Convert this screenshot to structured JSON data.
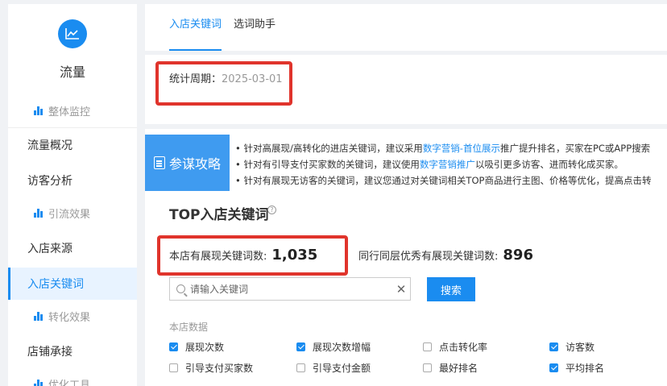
{
  "sidebar": {
    "title": "流量",
    "items": [
      {
        "label": "整体监控",
        "type": "sub"
      },
      {
        "label": "流量概况",
        "type": "top"
      },
      {
        "label": "访客分析",
        "type": "top"
      },
      {
        "label": "引流效果",
        "type": "sub"
      },
      {
        "label": "入店来源",
        "type": "top"
      },
      {
        "label": "入店关键词",
        "type": "top",
        "active": true
      },
      {
        "label": "转化效果",
        "type": "sub"
      },
      {
        "label": "店铺承接",
        "type": "top"
      },
      {
        "label": "优化工具",
        "type": "sub"
      }
    ]
  },
  "tabs": [
    {
      "label": "入店关键词",
      "active": true
    },
    {
      "label": "选词助手",
      "active": false
    }
  ],
  "period": {
    "label": "统计周期：",
    "value": "2025-03-01"
  },
  "tips": {
    "label": "参谋攻略",
    "lines": [
      {
        "pre": "• 针对高展现/高转化的进店关键词，建议采用",
        "link": "数字营销-首位展示",
        "post": "推广提升排名，买家在PC或APP搜索"
      },
      {
        "pre": "• 针对有引导支付买家数的关键词，建议使用",
        "link": "数字营销推广",
        "post": "以吸引更多访客、进而转化成买家。"
      },
      {
        "pre": "• 针对有展现无访客的关键词，建议您通过对关键词相关TOP商品进行主图、价格等优化，提高点击转",
        "link": "",
        "post": ""
      }
    ]
  },
  "section": {
    "title": "TOP入店关键词",
    "help_icon": "?"
  },
  "stats": {
    "shop_label": "本店有展现关键词数:",
    "shop_value": "1,035",
    "peer_label": "同行同层优秀有展现关键词数:",
    "peer_value": "896"
  },
  "search": {
    "placeholder": "请输入关键词",
    "value": "",
    "button": "搜索",
    "clear": "✕"
  },
  "metrics": {
    "group_label": "本店数据",
    "items": [
      {
        "label": "展现次数",
        "checked": true
      },
      {
        "label": "展现次数增幅",
        "checked": true
      },
      {
        "label": "点击转化率",
        "checked": false
      },
      {
        "label": "访客数",
        "checked": true
      },
      {
        "label": "引导支付买家数",
        "checked": false
      },
      {
        "label": "引导支付金额",
        "checked": false
      },
      {
        "label": "最好排名",
        "checked": false
      },
      {
        "label": "平均排名",
        "checked": true
      }
    ]
  },
  "colors": {
    "accent": "#1a8cf0",
    "highlight": "#e0342c",
    "tips_bg": "#3f9bf0"
  }
}
